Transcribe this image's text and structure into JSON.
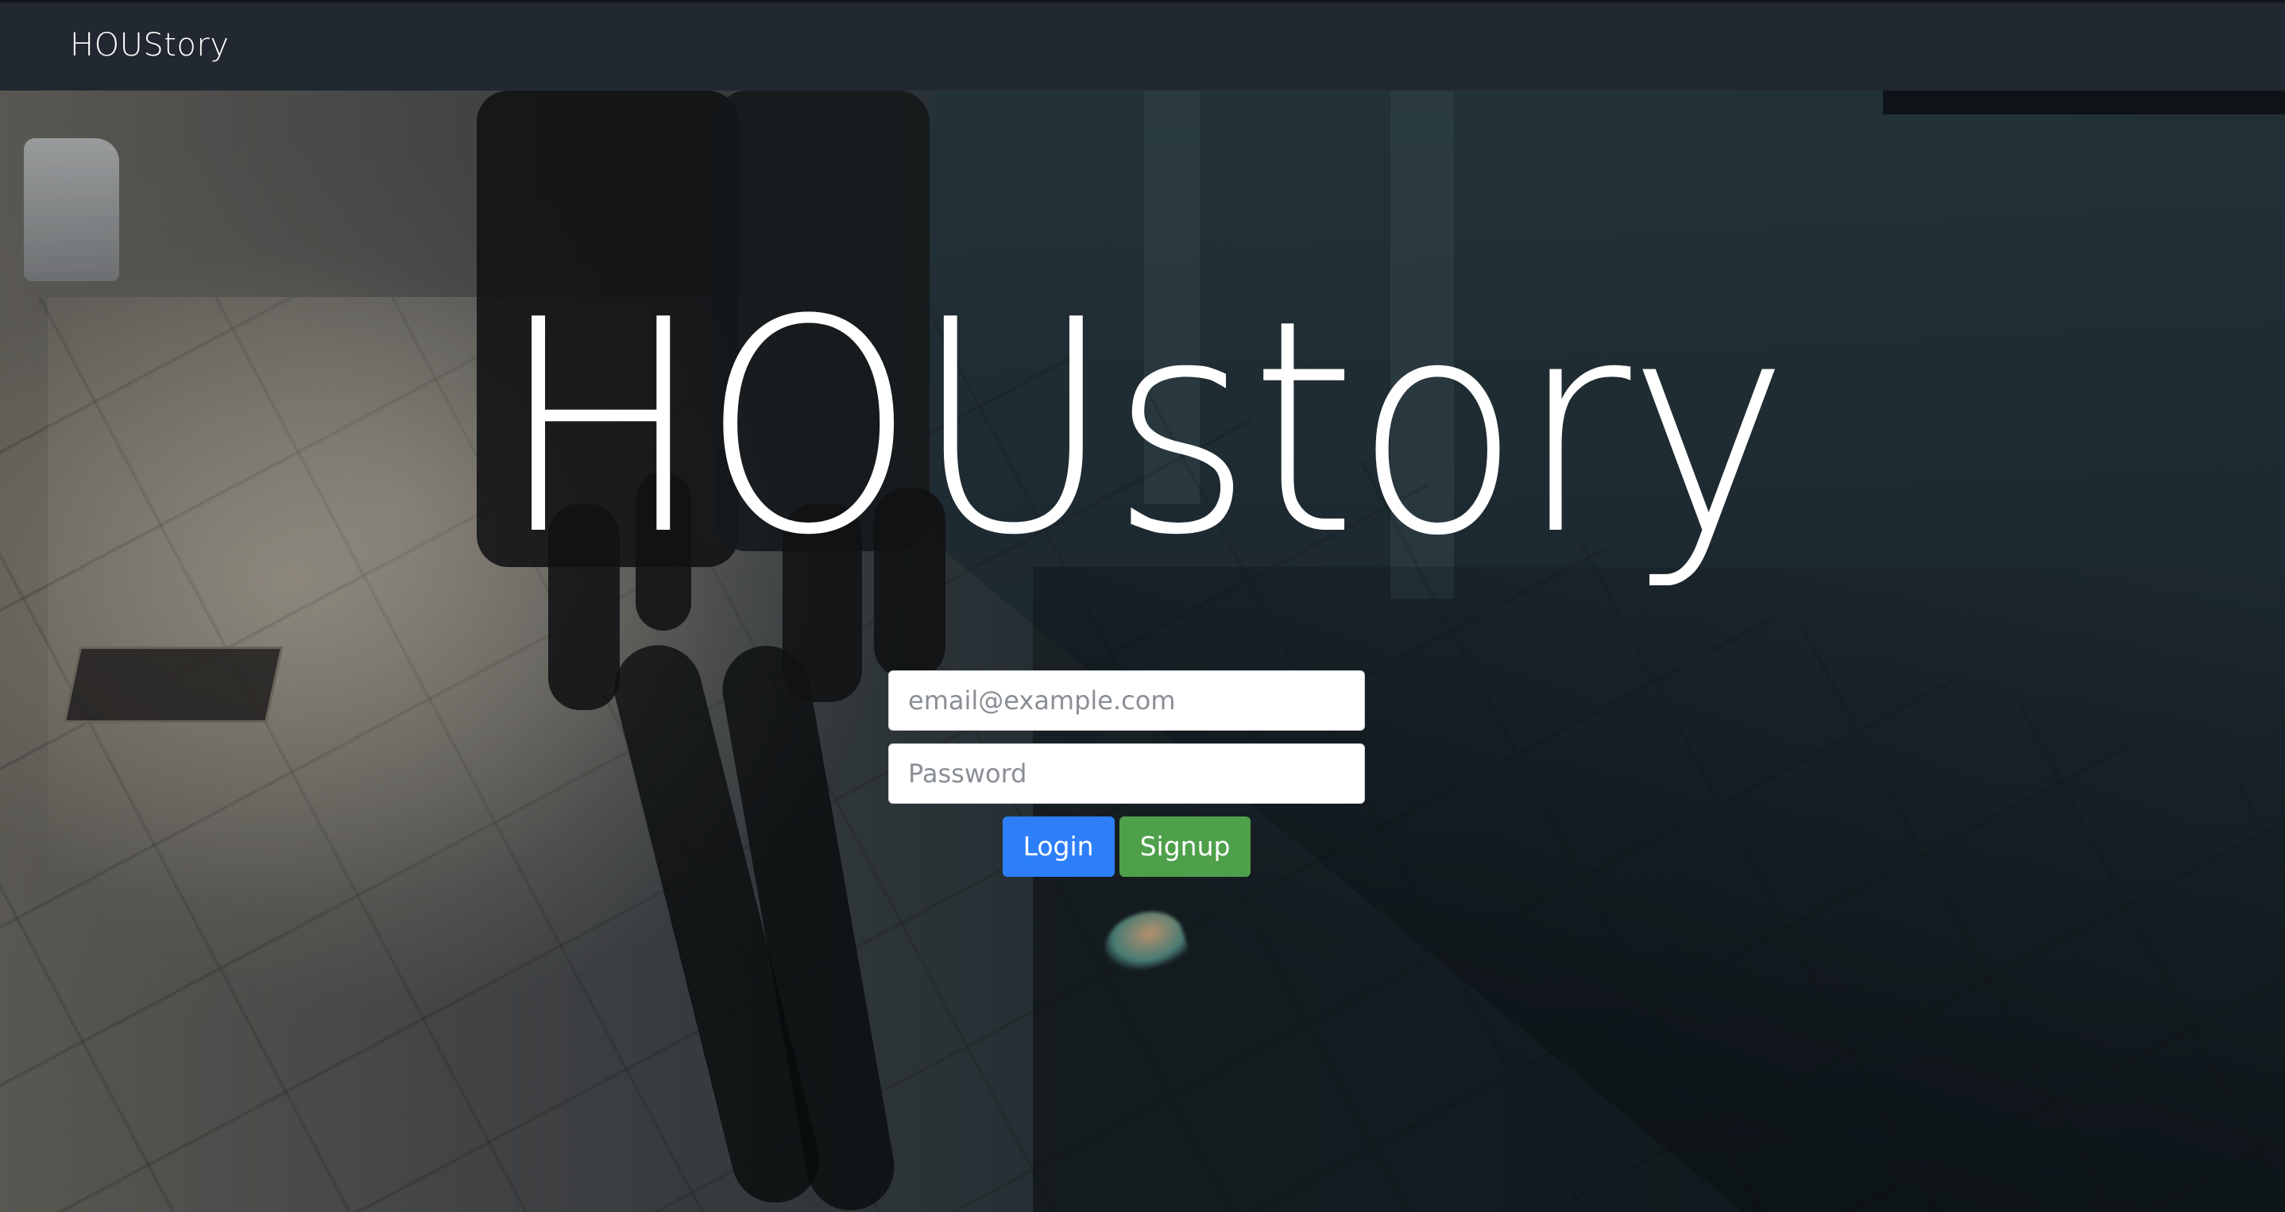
{
  "navbar": {
    "brand": "HOUStory"
  },
  "hero": {
    "title": "HOUstory"
  },
  "login_form": {
    "email_placeholder": "email@example.com",
    "email_value": "",
    "password_placeholder": "Password",
    "password_value": "",
    "login_label": "Login",
    "signup_label": "Signup"
  },
  "colors": {
    "navbar_bg": "#222831",
    "login_button": "#2d7ff9",
    "signup_button": "#4ea04a",
    "text": "#ffffff"
  }
}
